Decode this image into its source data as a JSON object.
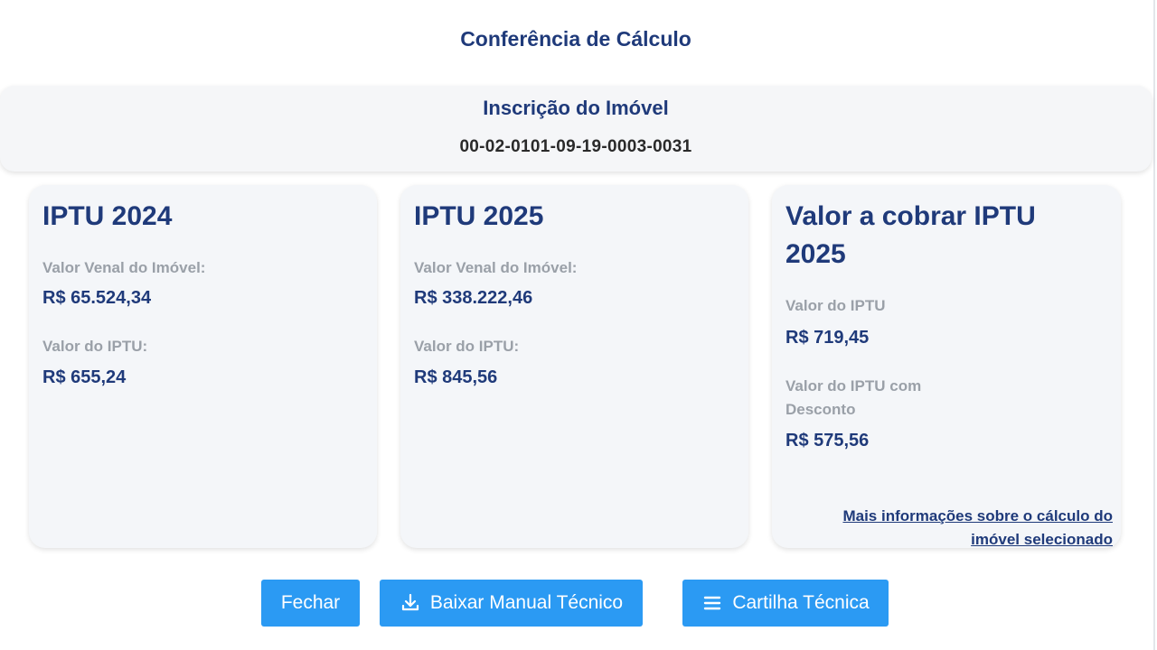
{
  "dialog": {
    "title": "Conferência de Cálculo"
  },
  "inscricao": {
    "label": "Inscrição do Imóvel",
    "value": "00-02-0101-09-19-0003-0031"
  },
  "cards": [
    {
      "title": "IPTU 2024",
      "fields": [
        {
          "label": "Valor Venal do Imóvel:",
          "value": "R$ 65.524,34"
        },
        {
          "label": "Valor do IPTU:",
          "value": "R$ 655,24"
        }
      ]
    },
    {
      "title": "IPTU 2025",
      "fields": [
        {
          "label": "Valor Venal do Imóvel:",
          "value": "R$ 338.222,46"
        },
        {
          "label": "Valor do IPTU:",
          "value": "R$ 845,56"
        }
      ]
    },
    {
      "title_line1": "Valor a cobrar IPTU",
      "title_line2": "2025",
      "fields": [
        {
          "label": "Valor do IPTU",
          "value": "R$ 719,45"
        },
        {
          "label_line1": "Valor do IPTU com",
          "label_line2": "Desconto",
          "value": "R$ 575,56"
        }
      ],
      "link_line1": "Mais informações sobre o cálculo do",
      "link_line2": "imóvel selecionado"
    }
  ],
  "buttons": {
    "close_label": "Fechar",
    "download_label": "Baixar Manual Técnico",
    "download_icon": "download-icon",
    "guide_label": "Cartilha Técnica",
    "guide_icon": "menu-icon"
  },
  "colors": {
    "primary_text": "#1f3a7a",
    "muted_label": "#9aa0a8",
    "button_bg": "#2b9af3",
    "card_bg": "#f4f6f9"
  }
}
